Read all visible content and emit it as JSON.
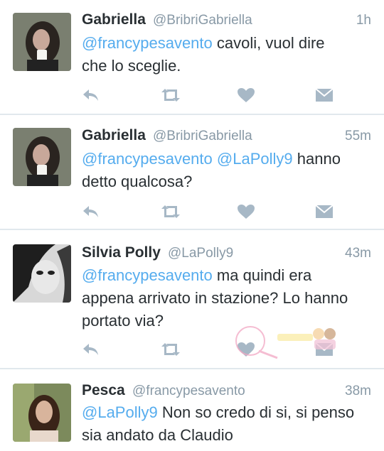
{
  "colors": {
    "link": "#55acee",
    "muted": "#8899a6",
    "text": "#292f33",
    "icon": "#a7b8c6",
    "divider": "#e1e8ed"
  },
  "tweets": [
    {
      "name": "Gabriella",
      "handle": "@BribriGabriella",
      "time": "1h",
      "mention": "@francypesavento",
      "text_line1": " cavoli, vuol dire",
      "text_line2": "che lo sceglie."
    },
    {
      "name": "Gabriella",
      "handle": "@BribriGabriella",
      "time": "55m",
      "mention1": "@francypesavento",
      "mention2": "@LaPolly9",
      "text_line1": " hanno",
      "text_line2": "detto qualcosa?"
    },
    {
      "name": "Silvia Polly",
      "handle": "@LaPolly9",
      "time": "43m",
      "mention": "@francypesavento",
      "text_line1": " ma quindi era",
      "text_line2": "appena arrivato in stazione? Lo hanno",
      "text_line3": "portato via?"
    },
    {
      "name": "Pesca",
      "handle": "@francypesavento",
      "time": "38m",
      "mention": "@LaPolly9",
      "text_line1": " Non so credo di si, si penso",
      "text_line2": "sia andato da Claudio"
    }
  ],
  "icons": {
    "reply": "reply-icon",
    "retweet": "retweet-icon",
    "like": "heart-icon",
    "dm": "envelope-icon"
  }
}
